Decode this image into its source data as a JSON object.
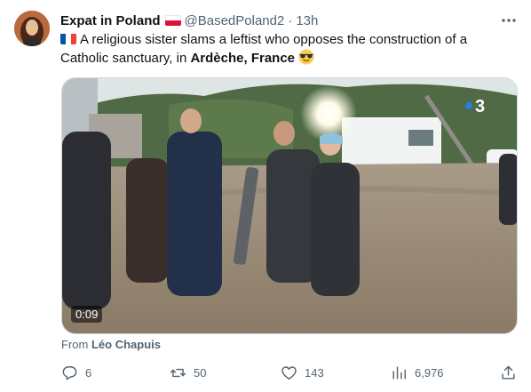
{
  "tweet": {
    "author": {
      "display_name": "Expat in Poland",
      "badge_icon": "poland-flag-icon",
      "handle": "@BasedPoland2",
      "separator": "·",
      "time": "13h"
    },
    "text": {
      "flag_icon": "france-flag-icon",
      "part1": "A religious sister slams a leftist who opposes the construction of a Catholic sanctuary, in ",
      "bold": "Ardèche, France",
      "emoji": "sunglasses-emoji"
    },
    "media": {
      "duration": "0:09",
      "watermark": "3",
      "from_prefix": "From",
      "from_author": "Léo Chapuis"
    },
    "actions": {
      "replies": "6",
      "reposts": "50",
      "likes": "143",
      "views": "6,976"
    },
    "colors": {
      "text": "#0f1419",
      "secondary": "#536471",
      "border": "#cfd9de"
    }
  }
}
